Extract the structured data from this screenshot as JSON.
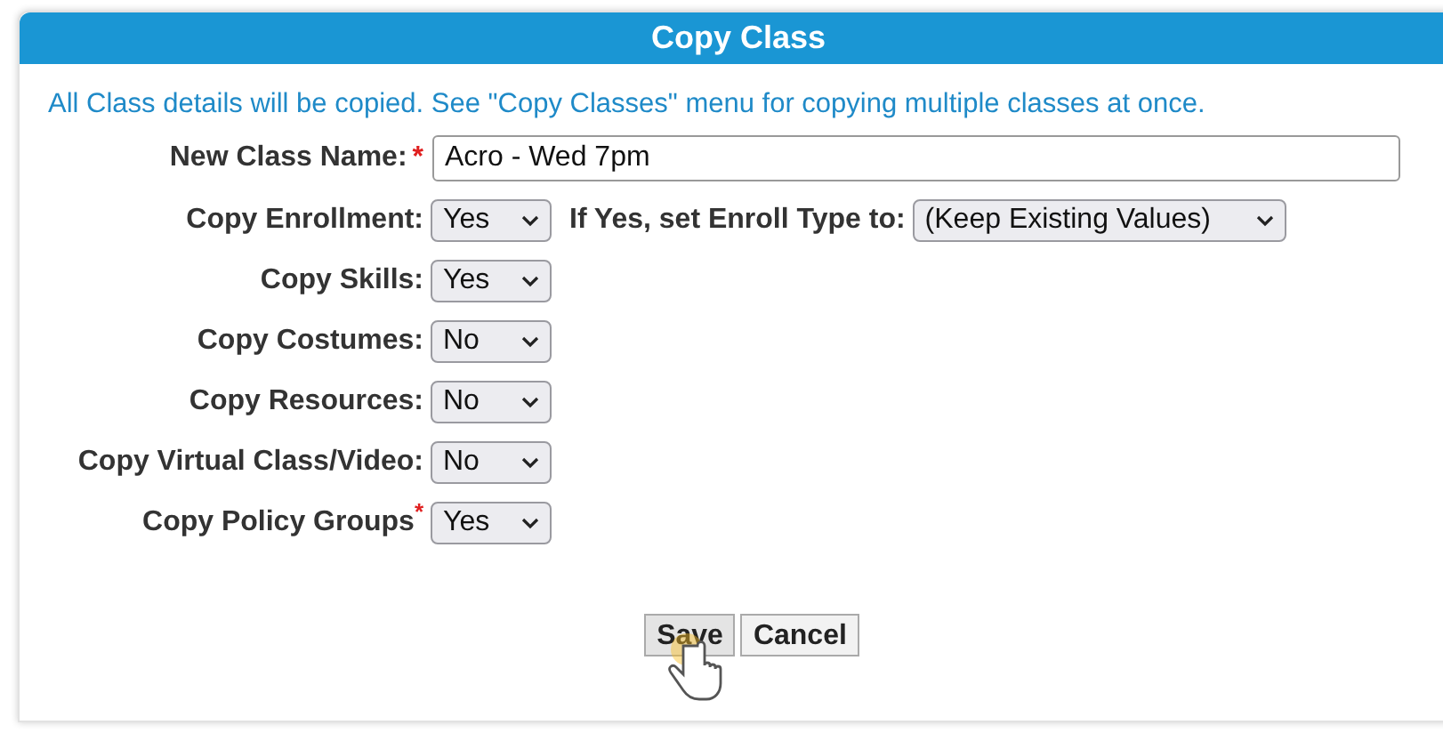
{
  "dialog": {
    "title": "Copy Class"
  },
  "notice": "All Class details will be copied. See \"Copy Classes\" menu for copying multiple classes at once.",
  "name_field": {
    "label": "New Class Name:",
    "required_mark": "*",
    "value": "Acro - Wed 7pm"
  },
  "options": [
    {
      "label": "Copy Enrollment:",
      "value": "Yes",
      "extra": {
        "label": "If Yes, set Enroll Type to:",
        "value": "(Keep Existing Values)"
      }
    },
    {
      "label": "Copy Skills:",
      "value": "Yes"
    },
    {
      "label": "Copy Costumes:",
      "value": "No"
    },
    {
      "label": "Copy Resources:",
      "value": "No"
    },
    {
      "label": "Copy Virtual Class/Video:",
      "value": "No"
    },
    {
      "label": "Copy Policy Groups",
      "required_mark": "*",
      "value": "Yes"
    }
  ],
  "buttons": [
    {
      "label": "Save",
      "hovered": true
    },
    {
      "label": "Cancel",
      "hovered": false
    }
  ]
}
